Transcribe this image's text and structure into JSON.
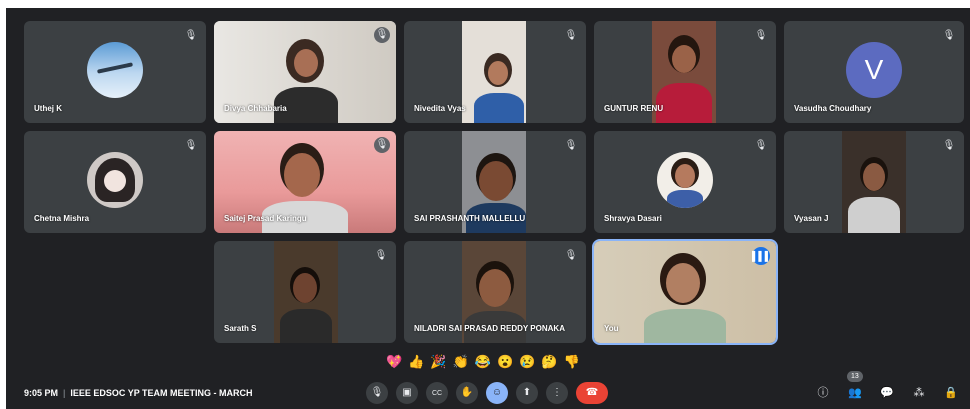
{
  "participants": [
    {
      "name": "Uthej K",
      "avatar": "airplane-photo-avatar",
      "mic": "muted"
    },
    {
      "name": "Divya Chhabaria",
      "mic": "muted"
    },
    {
      "name": "Nivedita Vyas",
      "mic": "muted"
    },
    {
      "name": "GUNTUR RENU",
      "mic": "muted"
    },
    {
      "name": "Vasudha Choudhary",
      "avatar_letter": "V",
      "mic": "muted"
    },
    {
      "name": "Chetna Mishra",
      "avatar": "anime-photo-avatar",
      "mic": "muted"
    },
    {
      "name": "Saitej Prasad Karingu",
      "mic": "muted"
    },
    {
      "name": "SAI PRASHANTH MALLELLU",
      "mic": "muted"
    },
    {
      "name": "Shravya Dasari",
      "avatar": "portrait-photo-avatar",
      "mic": "muted"
    },
    {
      "name": "Vyasan J",
      "mic": "muted"
    },
    {
      "name": "Sarath S",
      "mic": "muted"
    },
    {
      "name": "NILADRI SAI PRASAD REDDY PONAKA",
      "mic": "muted"
    },
    {
      "name": "You",
      "mic": "speaking"
    }
  ],
  "icons": {
    "mic_muted": "🎙",
    "speaking": "▌▌▌",
    "mic": "🎙",
    "camera": "▣",
    "captions": "CC",
    "hand": "✋",
    "emoji": "☺",
    "present": "⬆",
    "more": "⋮",
    "end": "☎",
    "info": "ⓘ",
    "people": "👥",
    "chat": "💬",
    "activities": "⁂",
    "lock": "🔒"
  },
  "reactions": [
    "💖",
    "👍",
    "🎉",
    "👏",
    "😂",
    "😮",
    "😢",
    "🤔",
    "👎"
  ],
  "footer": {
    "time": "9:05 PM",
    "meeting_title": "IEEE EDSOC YP TEAM MEETING - MARCH"
  },
  "people_count": "13",
  "colors": {
    "background": "#202124",
    "tile": "#3c4043",
    "end_call": "#ea4335",
    "speaking": "#1a73e8",
    "avatar_v": "#5c6bc0"
  }
}
